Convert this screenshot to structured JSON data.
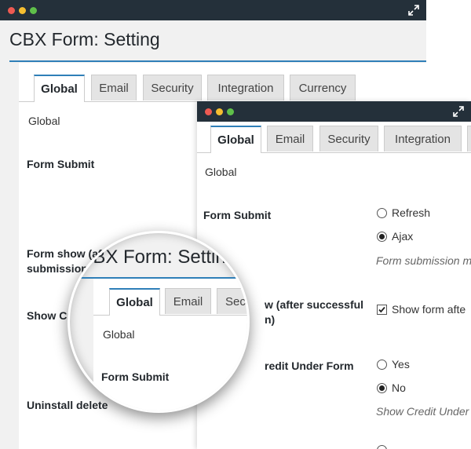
{
  "back_window": {
    "title": "CBX Form: Setting",
    "tabs": [
      "Global",
      "Email",
      "Security",
      "Integration",
      "Currency"
    ],
    "section_heading": "Global",
    "labels": {
      "form_submit": "Form Submit",
      "form_show_line1": "Form show (af",
      "form_show_line2": "submission)",
      "show_credit": "Show Cre",
      "uninstall": "Uninstall delete"
    }
  },
  "front_window": {
    "tabs": [
      "Global",
      "Email",
      "Security",
      "Integration"
    ],
    "section_heading": "Global",
    "form_submit": {
      "label": "Form Submit",
      "options": [
        "Refresh",
        "Ajax"
      ],
      "selected": "Ajax",
      "hint": "Form submission m"
    },
    "form_show": {
      "label_line1": "w (after successful",
      "label_line2": "n)",
      "checkbox_label": "Show form afte",
      "checked": true
    },
    "show_credit": {
      "label": "redit Under Form",
      "options": [
        "Yes",
        "No"
      ],
      "selected": "No",
      "hint": "Show Credit Under F"
    }
  },
  "magnifier": {
    "title": "CBX Form: Setting",
    "tabs": [
      "Global",
      "Email",
      "Secur"
    ],
    "section_heading": "Global",
    "form_submit_label": "Form Submit"
  },
  "colors": {
    "titlebar": "#24303a",
    "accent": "#2f7fb8",
    "close": "#ee5a52",
    "minimize": "#f5be30",
    "maximize": "#5fc04a"
  },
  "icons": [
    "expand-icon",
    "radio-icon",
    "checkbox-icon"
  ]
}
